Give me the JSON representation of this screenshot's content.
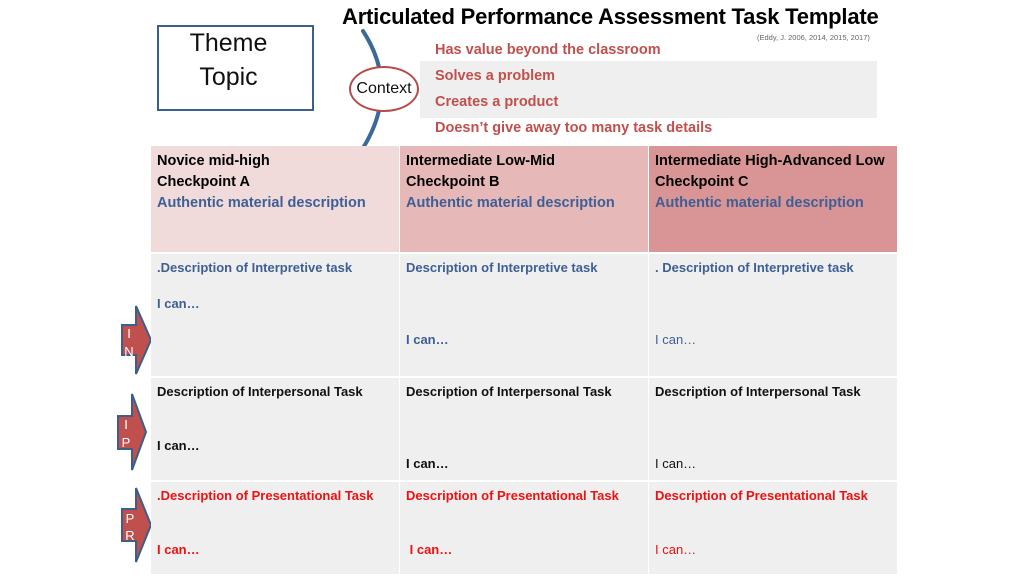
{
  "title": "Articulated Performance Assessment Task Template",
  "citation": "(Eddy, J. 2006, 2014, 2015, 2017)",
  "theme_box": {
    "line1": "Theme",
    "line2": "Topic"
  },
  "context_label": "Context",
  "criteria": [
    "Has value beyond the classroom",
    "Solves a problem",
    "Creates a product",
    "Doesn’t give away too many task details"
  ],
  "colors": {
    "criteria_text": "#c0504d",
    "header_a": "#f0dada",
    "header_b": "#e6b8b8",
    "header_c": "#d99595",
    "interpretive": "#3e5f95",
    "interpersonal": "#111111",
    "presentational": "#ee1111",
    "arrow_fill": "#c0504d",
    "arrow_border": "#3b5f8a"
  },
  "columns": [
    {
      "level": "Novice  mid-high",
      "checkpoint": "Checkpoint A",
      "authentic": " Authentic material description"
    },
    {
      "level": "Intermediate Low-Mid",
      "checkpoint": "Checkpoint B",
      "authentic": "Authentic material description"
    },
    {
      "level": "Intermediate High-Advanced Low",
      "checkpoint": "Checkpoint C",
      "authentic": "Authentic material description"
    }
  ],
  "rows": {
    "interpretive": {
      "arrow_letters": [
        "I",
        "N"
      ],
      "cells": [
        {
          "desc": ".Description of  Interpretive task",
          "ican": "I can…"
        },
        {
          "desc": "Description of  Interpretive task",
          "ican": "I can…"
        },
        {
          "desc": ". Description of  Interpretive task",
          "ican": "I can…"
        }
      ]
    },
    "interpersonal": {
      "arrow_letters": [
        "I",
        "P"
      ],
      "cells": [
        {
          "desc": "Description of Interpersonal Task",
          "ican": "I can…"
        },
        {
          "desc": "Description of Interpersonal Task",
          "ican": "I can…"
        },
        {
          "desc": "Description of Interpersonal Task",
          "ican": "I can…"
        }
      ]
    },
    "presentational": {
      "arrow_letters": [
        "P",
        "R"
      ],
      "cells": [
        {
          "desc": ".Description of Presentational Task",
          "ican": "I can…"
        },
        {
          "desc": "Description of Presentational Task",
          "ican": " I can…"
        },
        {
          "desc": "Description of Presentational Task",
          "ican": "I can…"
        }
      ]
    }
  }
}
